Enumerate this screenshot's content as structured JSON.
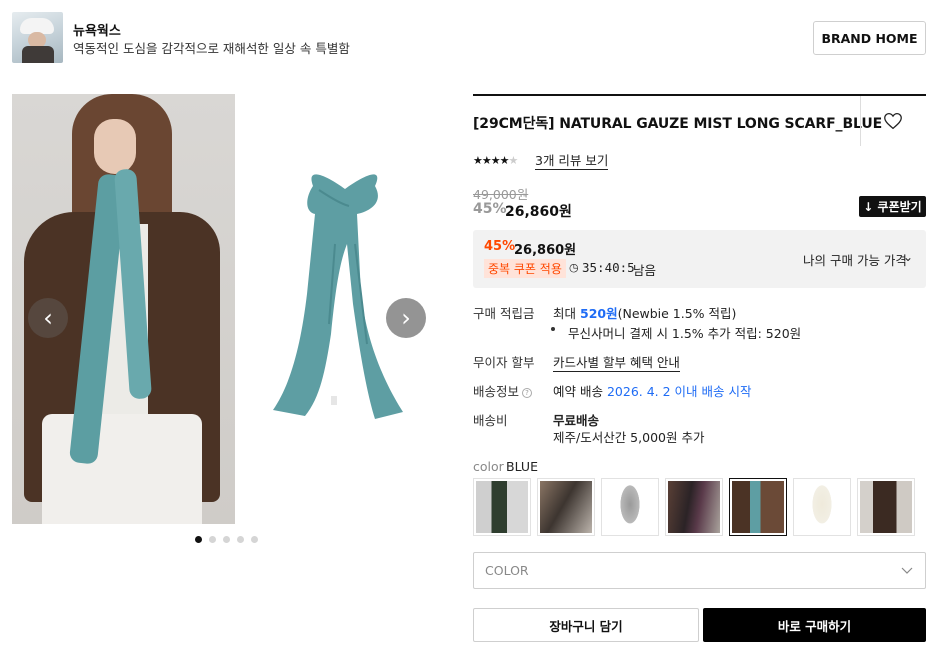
{
  "brand": {
    "name": "뉴욕웍스",
    "description": "역동적인 도심을 감각적으로 재해석한 일상 속 특별함",
    "home_button": "BRAND HOME"
  },
  "gallery": {
    "slide_count": 5,
    "active_slide": 1,
    "prev_icon": "chevron-left-icon",
    "next_icon": "chevron-right-icon"
  },
  "product": {
    "title": "[29CM단독] NATURAL GAUZE MIST LONG SCARF_BLUE",
    "rating_stars": 3.5,
    "rating_max": 5,
    "review_link": "3개 리뷰 보기",
    "original_price": "49,000원",
    "discount_rate": "45%",
    "sale_price": "26,860원",
    "coupon_button": "↓ 쿠폰받기"
  },
  "buy_box": {
    "discount_rate": "45%",
    "price": "26,860원",
    "coupon_badge": "중복 쿠폰 적용",
    "timer": "35:40:5",
    "remaining_label": "남음",
    "my_price_label": "나의 구매 가능 가격"
  },
  "info": {
    "points_label": "구매 적립금",
    "points_prefix": "최대",
    "points_amount": "520원",
    "points_suffix": "(Newbie 1.5% 적립)",
    "points_bullet": "무신사머니 결제 시 1.5% 추가 적립: 520원",
    "installment_label": "무이자 할부",
    "installment_link": "카드사별 할부 혜택 안내",
    "delivery_label": "배송정보",
    "delivery_prefix": "예약 배송",
    "delivery_date": "2026. 4. 2 이내 배송 시작",
    "shipping_fee_label": "배송비",
    "shipping_fee_value": "무료배송",
    "shipping_fee_extra": "제주/도서산간 5,000원 추가"
  },
  "color": {
    "label": "color",
    "selected": "BLUE",
    "selected_index": 4,
    "swatch_count": 7,
    "select_placeholder": "COLOR"
  },
  "actions": {
    "cart": "장바구니 담기",
    "buy": "바로 구매하기"
  },
  "colors": {
    "accent_orange": "#ff4800",
    "link_blue": "#1f6cf5",
    "scarf_blue": "#5e9ea3"
  }
}
